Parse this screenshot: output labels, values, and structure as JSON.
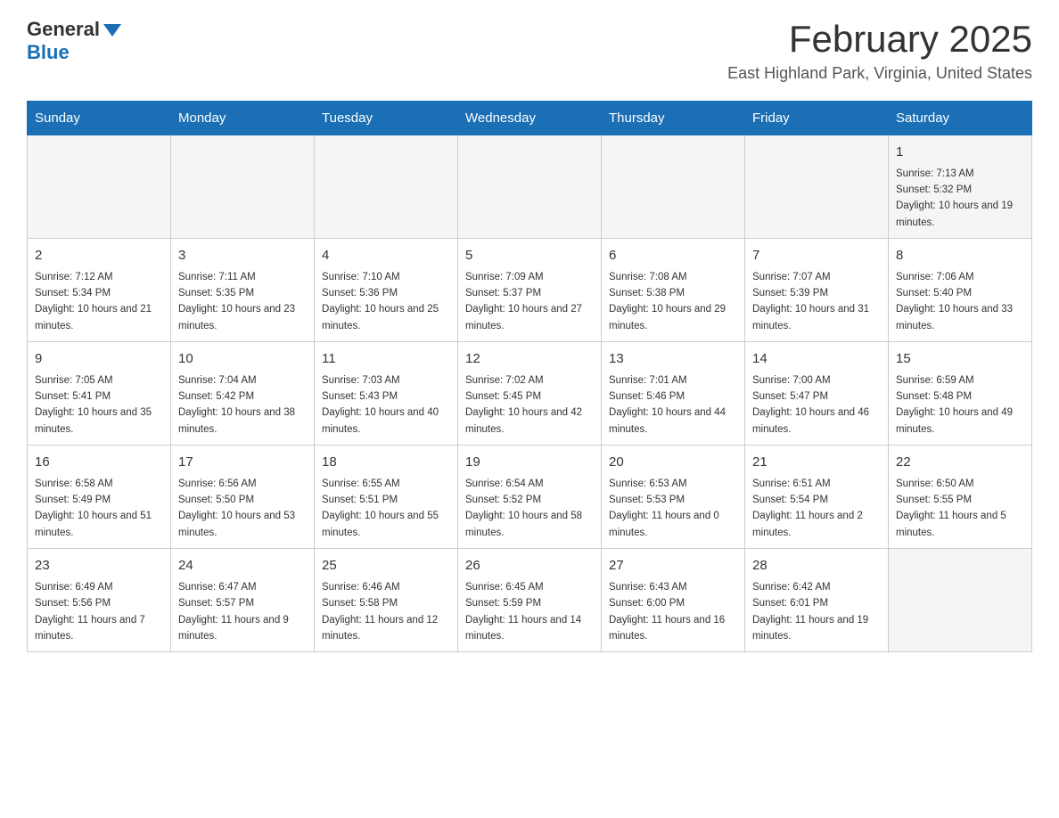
{
  "header": {
    "logo_general": "General",
    "logo_blue": "Blue",
    "title": "February 2025",
    "location": "East Highland Park, Virginia, United States"
  },
  "days_of_week": [
    "Sunday",
    "Monday",
    "Tuesday",
    "Wednesday",
    "Thursday",
    "Friday",
    "Saturday"
  ],
  "weeks": [
    {
      "days": [
        {
          "num": "",
          "info": ""
        },
        {
          "num": "",
          "info": ""
        },
        {
          "num": "",
          "info": ""
        },
        {
          "num": "",
          "info": ""
        },
        {
          "num": "",
          "info": ""
        },
        {
          "num": "",
          "info": ""
        },
        {
          "num": "1",
          "info": "Sunrise: 7:13 AM\nSunset: 5:32 PM\nDaylight: 10 hours and 19 minutes."
        }
      ]
    },
    {
      "days": [
        {
          "num": "2",
          "info": "Sunrise: 7:12 AM\nSunset: 5:34 PM\nDaylight: 10 hours and 21 minutes."
        },
        {
          "num": "3",
          "info": "Sunrise: 7:11 AM\nSunset: 5:35 PM\nDaylight: 10 hours and 23 minutes."
        },
        {
          "num": "4",
          "info": "Sunrise: 7:10 AM\nSunset: 5:36 PM\nDaylight: 10 hours and 25 minutes."
        },
        {
          "num": "5",
          "info": "Sunrise: 7:09 AM\nSunset: 5:37 PM\nDaylight: 10 hours and 27 minutes."
        },
        {
          "num": "6",
          "info": "Sunrise: 7:08 AM\nSunset: 5:38 PM\nDaylight: 10 hours and 29 minutes."
        },
        {
          "num": "7",
          "info": "Sunrise: 7:07 AM\nSunset: 5:39 PM\nDaylight: 10 hours and 31 minutes."
        },
        {
          "num": "8",
          "info": "Sunrise: 7:06 AM\nSunset: 5:40 PM\nDaylight: 10 hours and 33 minutes."
        }
      ]
    },
    {
      "days": [
        {
          "num": "9",
          "info": "Sunrise: 7:05 AM\nSunset: 5:41 PM\nDaylight: 10 hours and 35 minutes."
        },
        {
          "num": "10",
          "info": "Sunrise: 7:04 AM\nSunset: 5:42 PM\nDaylight: 10 hours and 38 minutes."
        },
        {
          "num": "11",
          "info": "Sunrise: 7:03 AM\nSunset: 5:43 PM\nDaylight: 10 hours and 40 minutes."
        },
        {
          "num": "12",
          "info": "Sunrise: 7:02 AM\nSunset: 5:45 PM\nDaylight: 10 hours and 42 minutes."
        },
        {
          "num": "13",
          "info": "Sunrise: 7:01 AM\nSunset: 5:46 PM\nDaylight: 10 hours and 44 minutes."
        },
        {
          "num": "14",
          "info": "Sunrise: 7:00 AM\nSunset: 5:47 PM\nDaylight: 10 hours and 46 minutes."
        },
        {
          "num": "15",
          "info": "Sunrise: 6:59 AM\nSunset: 5:48 PM\nDaylight: 10 hours and 49 minutes."
        }
      ]
    },
    {
      "days": [
        {
          "num": "16",
          "info": "Sunrise: 6:58 AM\nSunset: 5:49 PM\nDaylight: 10 hours and 51 minutes."
        },
        {
          "num": "17",
          "info": "Sunrise: 6:56 AM\nSunset: 5:50 PM\nDaylight: 10 hours and 53 minutes."
        },
        {
          "num": "18",
          "info": "Sunrise: 6:55 AM\nSunset: 5:51 PM\nDaylight: 10 hours and 55 minutes."
        },
        {
          "num": "19",
          "info": "Sunrise: 6:54 AM\nSunset: 5:52 PM\nDaylight: 10 hours and 58 minutes."
        },
        {
          "num": "20",
          "info": "Sunrise: 6:53 AM\nSunset: 5:53 PM\nDaylight: 11 hours and 0 minutes."
        },
        {
          "num": "21",
          "info": "Sunrise: 6:51 AM\nSunset: 5:54 PM\nDaylight: 11 hours and 2 minutes."
        },
        {
          "num": "22",
          "info": "Sunrise: 6:50 AM\nSunset: 5:55 PM\nDaylight: 11 hours and 5 minutes."
        }
      ]
    },
    {
      "days": [
        {
          "num": "23",
          "info": "Sunrise: 6:49 AM\nSunset: 5:56 PM\nDaylight: 11 hours and 7 minutes."
        },
        {
          "num": "24",
          "info": "Sunrise: 6:47 AM\nSunset: 5:57 PM\nDaylight: 11 hours and 9 minutes."
        },
        {
          "num": "25",
          "info": "Sunrise: 6:46 AM\nSunset: 5:58 PM\nDaylight: 11 hours and 12 minutes."
        },
        {
          "num": "26",
          "info": "Sunrise: 6:45 AM\nSunset: 5:59 PM\nDaylight: 11 hours and 14 minutes."
        },
        {
          "num": "27",
          "info": "Sunrise: 6:43 AM\nSunset: 6:00 PM\nDaylight: 11 hours and 16 minutes."
        },
        {
          "num": "28",
          "info": "Sunrise: 6:42 AM\nSunset: 6:01 PM\nDaylight: 11 hours and 19 minutes."
        },
        {
          "num": "",
          "info": ""
        }
      ]
    }
  ]
}
